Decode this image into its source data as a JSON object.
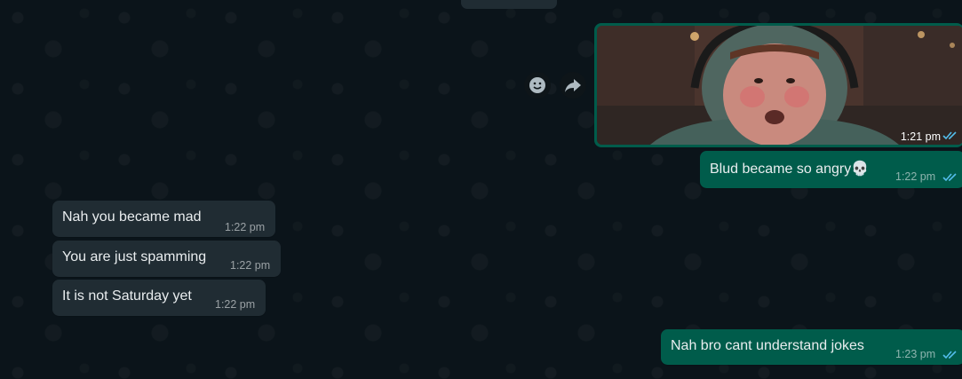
{
  "chat": {
    "incoming": [
      {
        "text": "Nah you became mad",
        "time": "1:22 pm"
      },
      {
        "text": "You are just spamming",
        "time": "1:22 pm"
      },
      {
        "text": "It is not Saturday yet",
        "time": "1:22 pm"
      }
    ],
    "outgoing": [
      {
        "text": "Blud became so angry💀",
        "time": "1:22 pm"
      },
      {
        "text": "Nah bro cant understand jokes",
        "time": "1:23 pm"
      }
    ],
    "image_message": {
      "time": "1:21 pm",
      "read": true
    },
    "icons": {
      "react": "emoji-smile-icon",
      "forward": "forward-arrow-icon",
      "ticks": "double-check-read-icon"
    },
    "colors": {
      "background": "#0b141a",
      "incoming_bubble": "#202c33",
      "outgoing_bubble": "#005c4b",
      "read_ticks": "#53bdeb"
    }
  }
}
